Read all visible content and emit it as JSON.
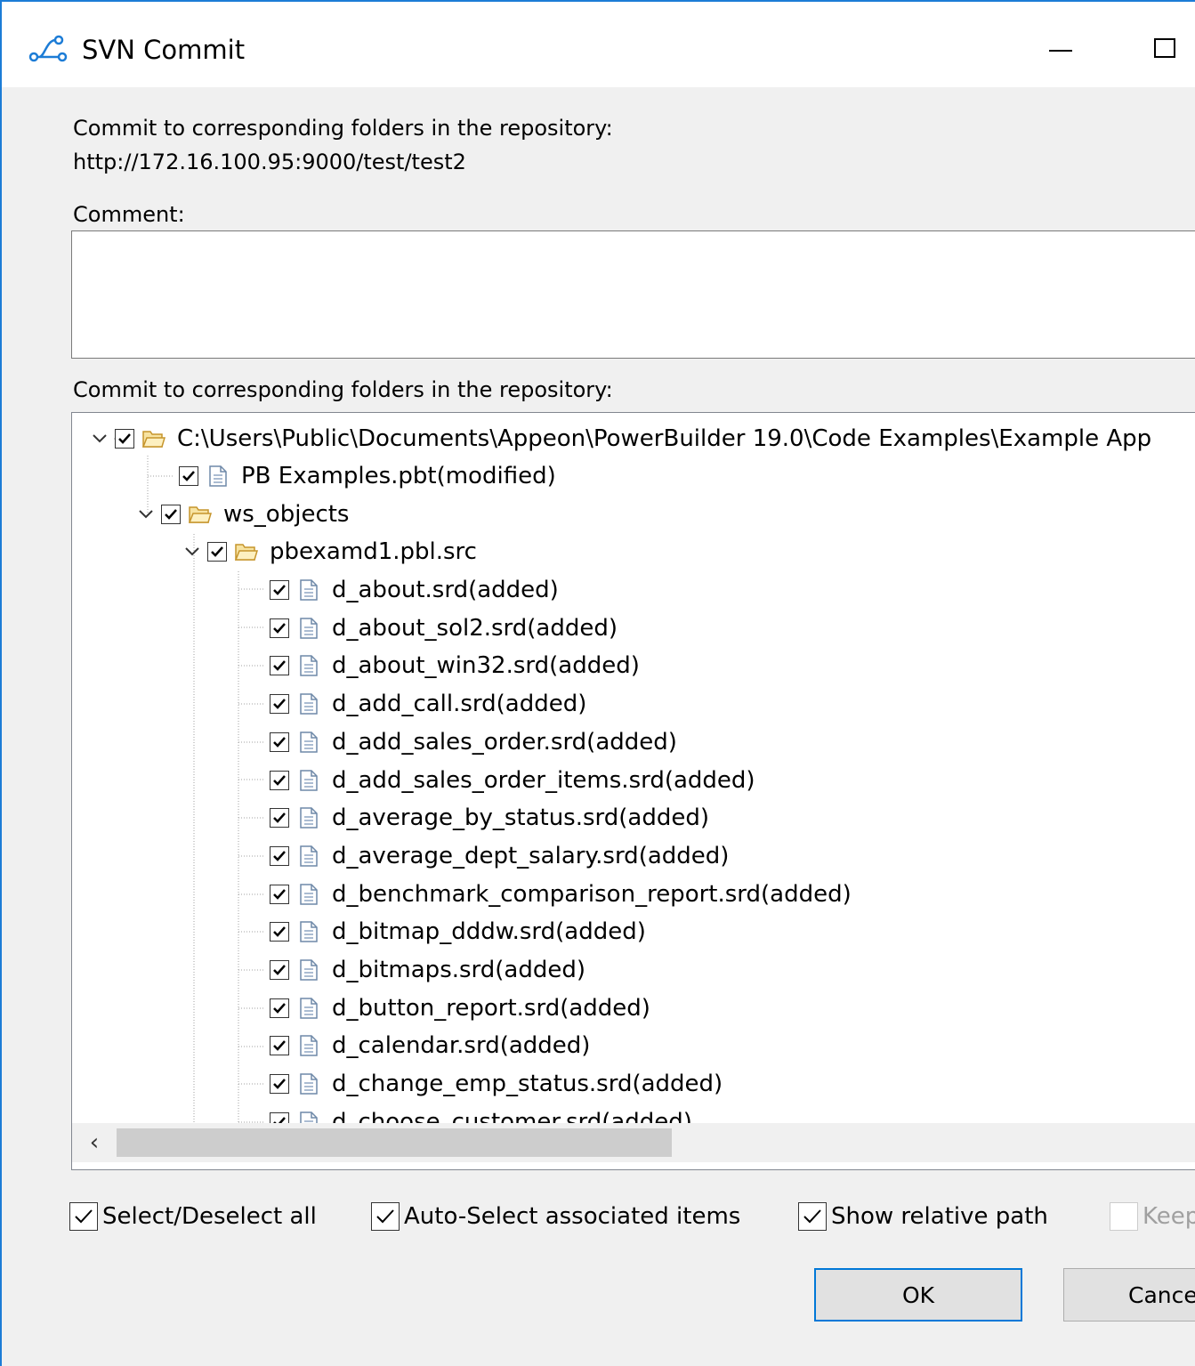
{
  "window": {
    "title": "SVN Commit",
    "accent": "#1c7cd6"
  },
  "header": {
    "line1": "Commit to corresponding folders in the repository:",
    "url": "http://172.16.100.95:9000/test/test2",
    "comment_label": "Comment:",
    "comment_value": "",
    "list_label": "Commit to corresponding folders in the repository:"
  },
  "tree": {
    "root": "C:\\Users\\Public\\Documents\\Appeon\\PowerBuilder 19.0\\Code Examples\\Example App",
    "pbt": "PB Examples.pbt(modified)",
    "ws_objects": "ws_objects",
    "pbl": "pbexamd1.pbl.src",
    "files": [
      "d_about.srd(added)",
      "d_about_sol2.srd(added)",
      "d_about_win32.srd(added)",
      "d_add_call.srd(added)",
      "d_add_sales_order.srd(added)",
      "d_add_sales_order_items.srd(added)",
      "d_average_by_status.srd(added)",
      "d_average_dept_salary.srd(added)",
      "d_benchmark_comparison_report.srd(added)",
      "d_bitmap_dddw.srd(added)",
      "d_bitmaps.srd(added)",
      "d_button_report.srd(added)",
      "d_calendar.srd(added)",
      "d_change_emp_status.srd(added)",
      "d_choose_customer.srd(added)"
    ]
  },
  "options": {
    "select_all": "Select/Deselect all",
    "auto_select": "Auto-Select associated items",
    "relative_path": "Show relative path",
    "keep_locks": "Keep"
  },
  "buttons": {
    "ok": "OK",
    "cancel": "Cance"
  }
}
